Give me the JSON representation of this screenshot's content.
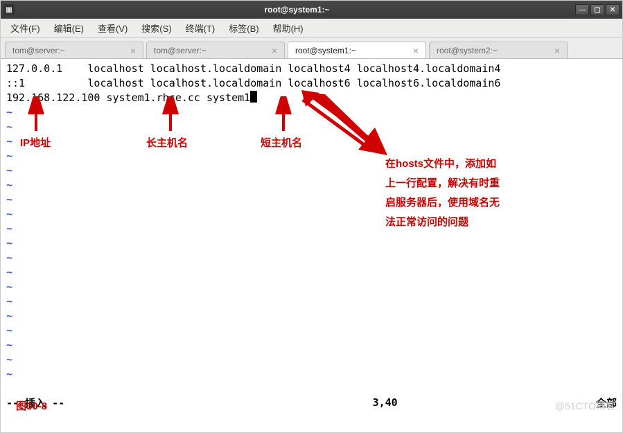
{
  "window": {
    "title": "root@system1:~"
  },
  "menu": {
    "file": "文件(F)",
    "edit": "编辑(E)",
    "view": "查看(V)",
    "search": "搜索(S)",
    "terminal": "终端(T)",
    "tabs": "标签(B)",
    "help": "帮助(H)"
  },
  "tabs": [
    {
      "label": "tom@server:~",
      "active": false
    },
    {
      "label": "tom@server:~",
      "active": false
    },
    {
      "label": "root@system1:~",
      "active": true
    },
    {
      "label": "root@system2:~",
      "active": false
    }
  ],
  "file_lines": [
    "127.0.0.1    localhost localhost.localdomain localhost4 localhost4.localdomain4",
    "::1          localhost localhost.localdomain localhost6 localhost6.localdomain6",
    "192.168.122.100 system1.rhce.cc system1"
  ],
  "tilde": "~",
  "status": {
    "mode": "-- 插入 --",
    "pos": "3,40",
    "scroll": "全部"
  },
  "annotations": {
    "ip": "IP地址",
    "fqdn": "长主机名",
    "short": "短主机名",
    "note1": "在hosts文件中，添加如",
    "note2": "上一行配置，解决有时重",
    "note3": "启服务器后，使用域名无",
    "note4": "法正常访问的问题",
    "figure": "图30-8"
  },
  "watermark": "@51CTO博客"
}
